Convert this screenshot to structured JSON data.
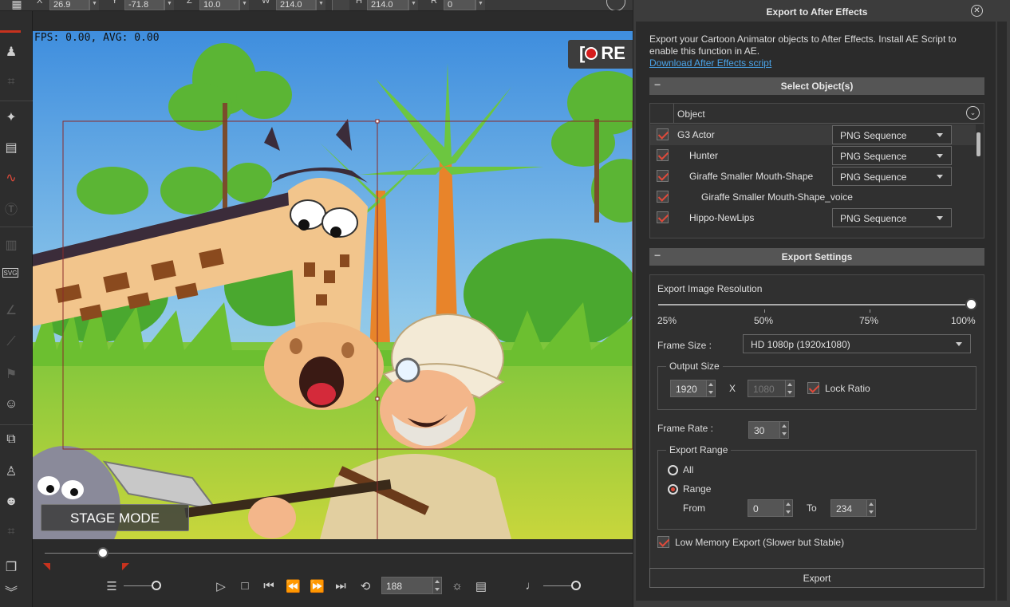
{
  "toolbar": {
    "x_label": "X",
    "x_value": "26.9",
    "y_label": "Y",
    "y_value": "-71.8",
    "z_label": "Z",
    "z_value": "10.0",
    "w_label": "W",
    "w_value": "214.0",
    "h_label": "H",
    "h_value": "214.0",
    "r_label": "R",
    "r_value": "0"
  },
  "stage": {
    "fps_text": "FPS: 0.00, AVG: 0.00",
    "rec_label": "RE",
    "mode_label": "STAGE MODE"
  },
  "timeline": {
    "current_frame": "188",
    "position": 0.11
  },
  "panel": {
    "title": "Export to After Effects",
    "description": "Export your Cartoon Animator objects to After Effects. Install AE Script to enable this function in AE.",
    "download_link": "Download After Effects script",
    "select_section": "Select Object(s)",
    "object_header": "Object",
    "objects": [
      {
        "name": "G3 Actor",
        "format": "PNG Sequence",
        "checked": true
      },
      {
        "name": "Hunter",
        "format": "PNG Sequence",
        "checked": true
      },
      {
        "name": "Giraffe Smaller Mouth-Shape",
        "format": "PNG Sequence",
        "checked": true
      },
      {
        "name": "Giraffe Smaller Mouth-Shape_voice",
        "format": "",
        "checked": true
      },
      {
        "name": "Hippo-NewLips",
        "format": "PNG Sequence",
        "checked": true
      }
    ],
    "settings_section": "Export Settings",
    "resolution_label": "Export Image Resolution",
    "resolution_ticks": [
      "25%",
      "50%",
      "75%",
      "100%"
    ],
    "resolution_value": 1.0,
    "frame_size_label": "Frame Size :",
    "frame_size_value": "HD 1080p (1920x1080)",
    "output_size_label": "Output Size",
    "output_width": "1920",
    "output_x": "X",
    "output_height": "1080",
    "lock_ratio_label": "Lock Ratio",
    "frame_rate_label": "Frame Rate :",
    "frame_rate_value": "30",
    "export_range_label": "Export Range",
    "range_all": "All",
    "range_range": "Range",
    "from_label": "From",
    "from_value": "0",
    "to_label": "To",
    "to_value": "234",
    "low_memory_label": "Low Memory Export (Slower but Stable)",
    "export_button": "Export"
  },
  "colors": {
    "accent_red": "#e04a3a",
    "link_blue": "#4aa3e8",
    "panel_bg": "#2b2b2b"
  }
}
